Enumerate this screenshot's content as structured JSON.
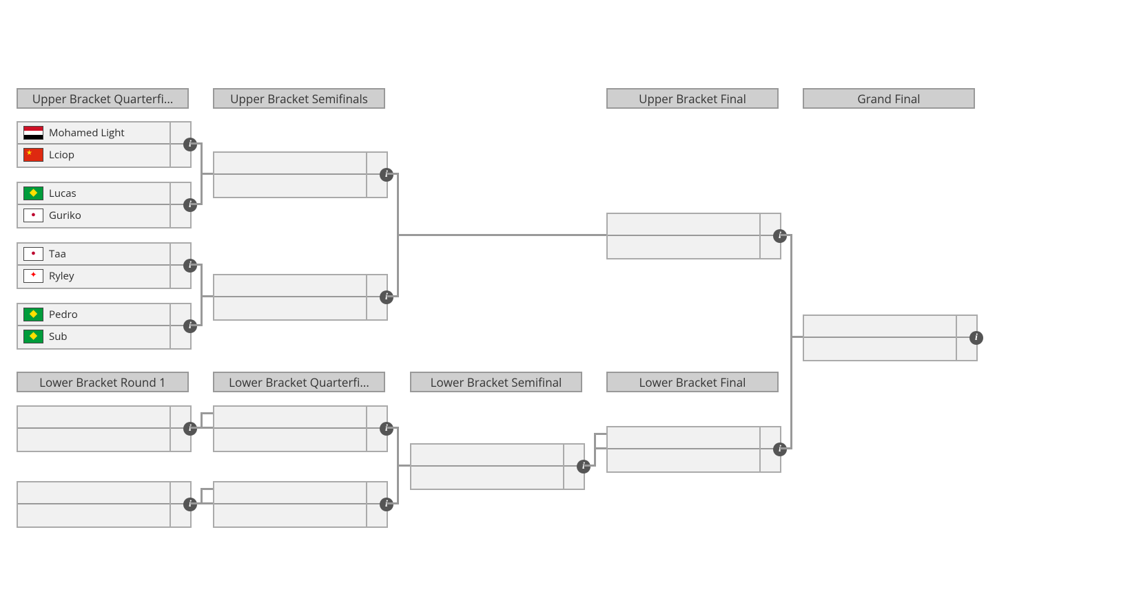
{
  "headers": {
    "uqf": "Upper Bracket Quarterfi...",
    "usf": "Upper Bracket Semifinals",
    "ubf": "Upper Bracket Final",
    "gf": "Grand Final",
    "lr1": "Lower Bracket Round 1",
    "lqf": "Lower Bracket Quarterfi...",
    "lsf": "Lower Bracket Semifinal",
    "lbf": "Lower Bracket Final"
  },
  "teams": {
    "mohamed": {
      "name": "Mohamed Light",
      "flag": "EG"
    },
    "lciop": {
      "name": "Lciop",
      "flag": "CN"
    },
    "lucas": {
      "name": "Lucas",
      "flag": "BR"
    },
    "guriko": {
      "name": "Guriko",
      "flag": "JP"
    },
    "taa": {
      "name": "Taa",
      "flag": "JP"
    },
    "ryley": {
      "name": "Ryley",
      "flag": "CA"
    },
    "pedro": {
      "name": "Pedro",
      "flag": "BR"
    },
    "sub": {
      "name": "Sub",
      "flag": "BR"
    }
  }
}
